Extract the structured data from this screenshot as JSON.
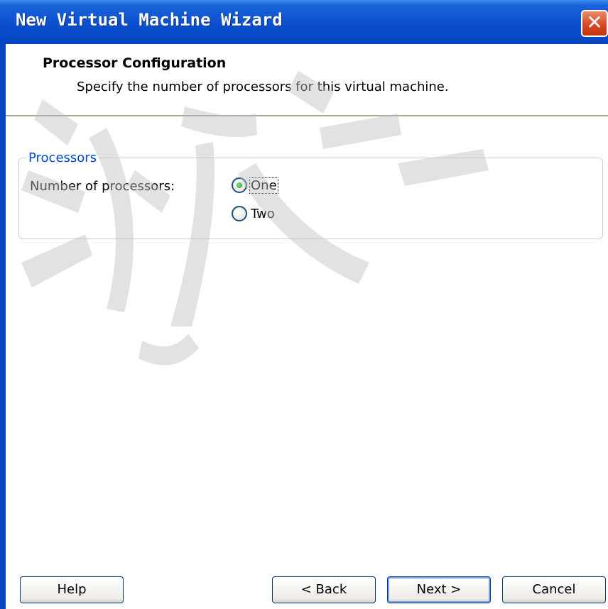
{
  "window": {
    "title": "New Virtual Machine Wizard",
    "close_glyph": "✕",
    "close_icon": "close-icon"
  },
  "header": {
    "title": "Processor Configuration",
    "subtitle": "Specify the number of processors for this virtual machine."
  },
  "processors": {
    "group_label": "Processors",
    "field_label": "Number of processors:",
    "options": [
      {
        "label": "One",
        "selected": true
      },
      {
        "label": "Two",
        "selected": false
      }
    ]
  },
  "buttons": {
    "help": "Help",
    "back": "< Back",
    "next": "Next >",
    "cancel": "Cancel"
  },
  "colors": {
    "titlebar": "#0846bf",
    "group_legend": "#0046d5",
    "close_button": "#d6451f"
  }
}
